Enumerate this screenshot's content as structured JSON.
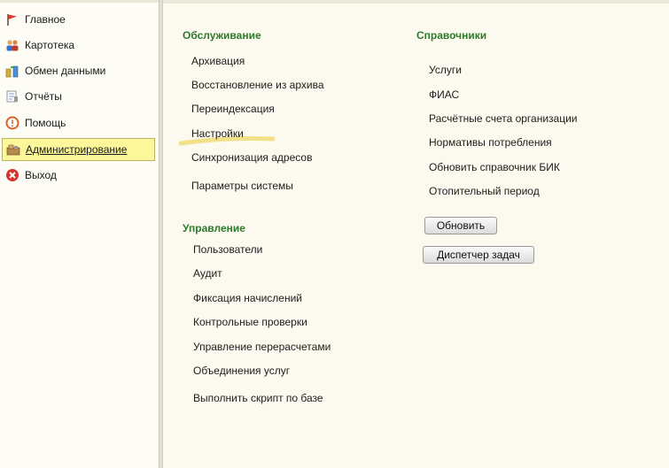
{
  "sidebar": {
    "items": [
      {
        "label": "Главное",
        "icon": "flag-icon"
      },
      {
        "label": "Картотека",
        "icon": "people-icon"
      },
      {
        "label": "Обмен данными",
        "icon": "data-exchange-icon"
      },
      {
        "label": "Отчёты",
        "icon": "reports-icon"
      },
      {
        "label": "Помощь",
        "icon": "help-icon"
      },
      {
        "label": "Администрирование",
        "icon": "administration-icon",
        "active": true
      },
      {
        "label": "Выход",
        "icon": "exit-icon"
      }
    ]
  },
  "main": {
    "service": {
      "title": "Обслуживание",
      "items": [
        "Архивация",
        "Восстановление из архива",
        "Переиндексация",
        "Настройки",
        "Синхронизация адресов",
        "Параметры системы"
      ]
    },
    "management": {
      "title": "Управление",
      "items": [
        "Пользователи",
        "Аудит",
        "Фиксация начислений",
        "Контрольные проверки",
        "Управление перерасчетами",
        "Объединения услуг",
        "Выполнить скрипт по базе"
      ]
    },
    "references": {
      "title": "Справочники",
      "items": [
        "Услуги",
        "ФИАС",
        "Расчётные счета организации",
        "Нормативы потребления",
        "Обновить справочник БИК",
        "Отопительный период"
      ]
    },
    "buttons": {
      "refresh": "Обновить",
      "task_manager": "Диспетчер задач"
    }
  },
  "colors": {
    "group_title": "#2c7a2c",
    "active_nav": "#fbf79a",
    "highlight_stroke": "#f3e08a"
  }
}
